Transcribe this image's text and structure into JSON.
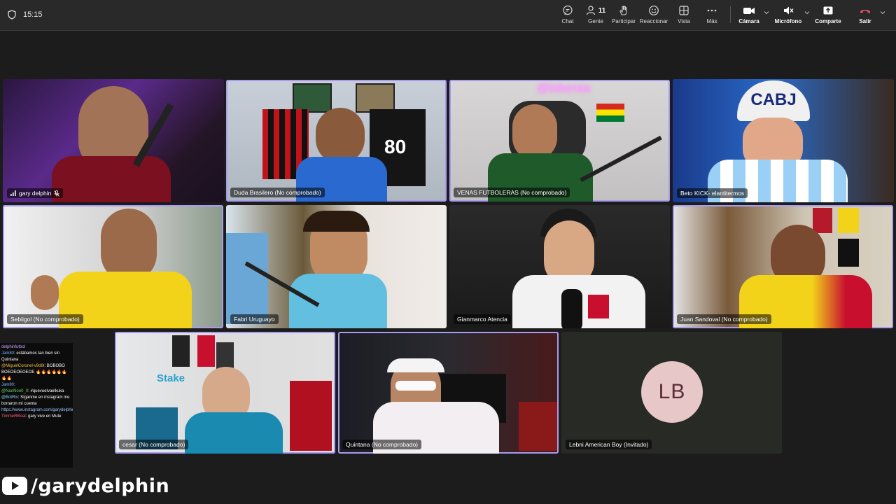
{
  "topbar": {
    "time": "15:15",
    "chat_label": "Chat",
    "people_label": "Gente",
    "people_count": "11",
    "raise_label": "Participar",
    "react_label": "Reaccionar",
    "view_label": "Vista",
    "more_label": "Más",
    "camera_label": "Cámara",
    "mic_label": "Micrófono",
    "share_label": "Comparte",
    "leave_label": "Salir",
    "leave_color": "#e8555d"
  },
  "participants": [
    {
      "name": "gary delphin"
    },
    {
      "name": "Duda Brasilero (No comprobado)"
    },
    {
      "name": "VENAS FUTBOLERAS (No comprobado)"
    },
    {
      "name": "Beto KICK- elantitermos"
    },
    {
      "name": "Sebiigol (No comprobado)"
    },
    {
      "name": "Fabri Uruguayo"
    },
    {
      "name": "Gianmarco Atencia"
    },
    {
      "name": "Juan Sandoval (No comprobado)"
    },
    {
      "name": "cesar (No comprobado)"
    },
    {
      "name": "Quintana (No comprobado)"
    },
    {
      "name": "Lebni American Boy (Invitado)",
      "initials": "LB"
    }
  ],
  "overlay_chat": {
    "channel": "delphinfutbol",
    "messages": [
      {
        "user": "Jam80",
        "text": ": estábamos tan bien sin Quintana"
      },
      {
        "user": "@MiguelCoronel-v9d8t",
        "text": ": BOBOBO BOEOEOEOEOE"
      },
      {
        "user": "Jam80",
        "text": ":"
      },
      {
        "user": "@NaoNoo0_0",
        "text": ": #quevuelvaelkuka"
      },
      {
        "user": "@BotRix",
        "text": ": Síganme en instagram me borraron mi cuenta"
      },
      {
        "user": "",
        "text": "https://www.instagram.com/garydelphinfutbol"
      },
      {
        "user": "TimmeRBoat",
        "text": ": gary vive en Mute"
      }
    ]
  },
  "brand": {
    "handle": "/garydelphin"
  }
}
